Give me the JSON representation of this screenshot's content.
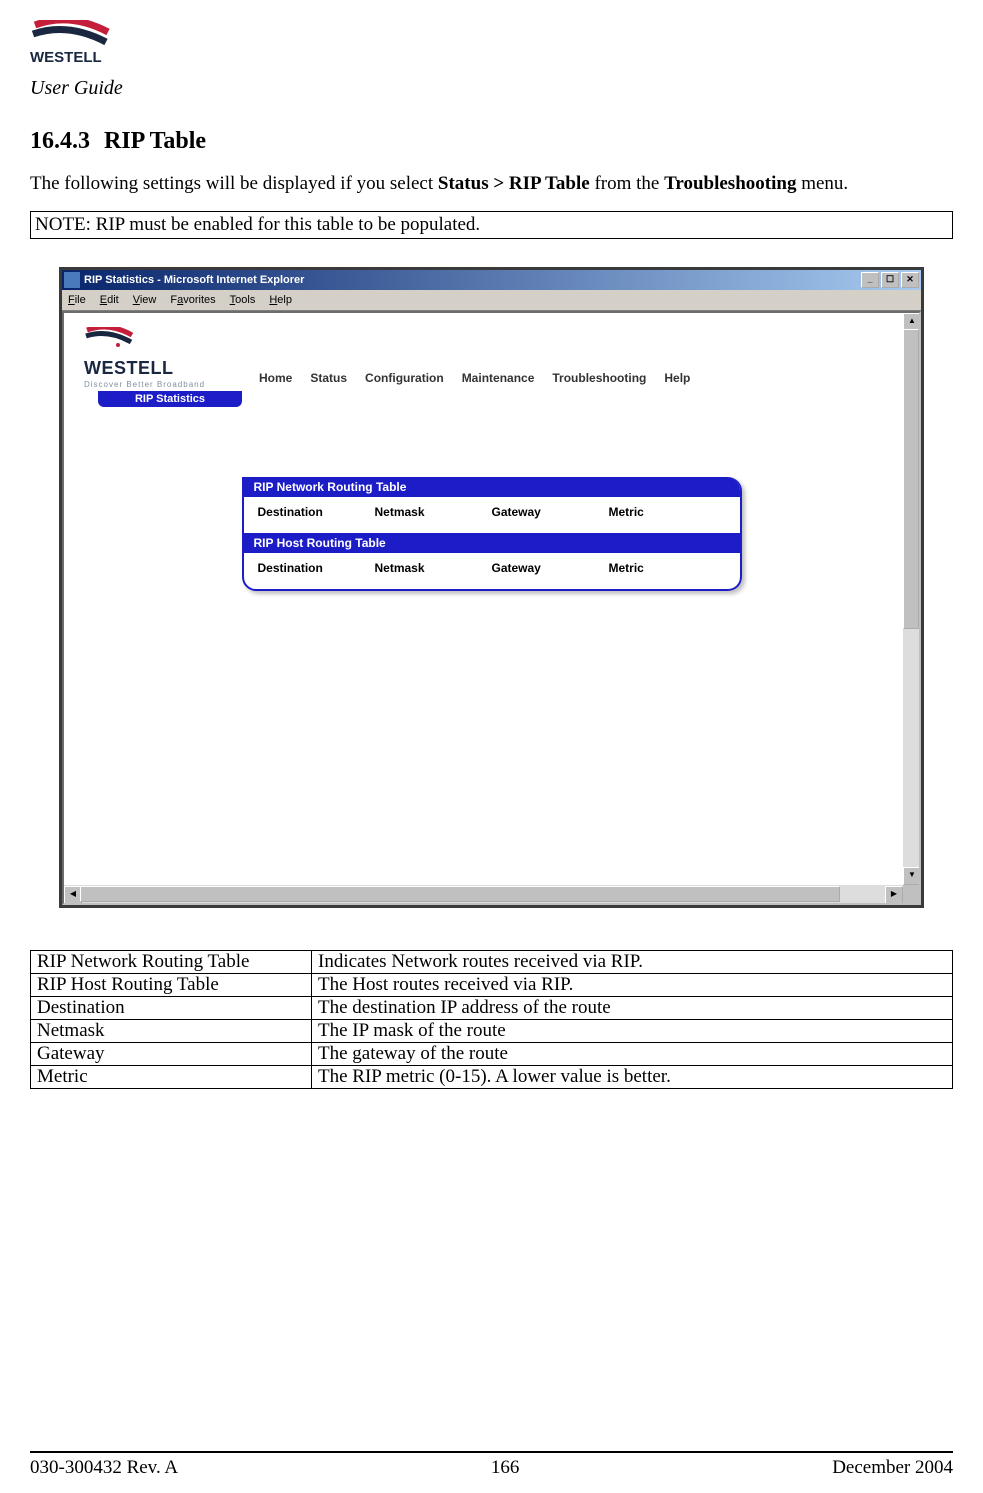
{
  "header": {
    "user_guide": "User Guide"
  },
  "section": {
    "number": "16.4.3",
    "title": "RIP Table"
  },
  "body": {
    "intro_pre": "The following settings will be displayed if you select ",
    "intro_bold1": "Status > RIP Table",
    "intro_mid": " from the ",
    "intro_bold2": "Troubleshooting",
    "intro_post": " menu.",
    "note": "NOTE: RIP must be enabled for this table to be populated."
  },
  "ie": {
    "title": "RIP Statistics - Microsoft Internet Explorer",
    "menu": [
      "File",
      "Edit",
      "View",
      "Favorites",
      "Tools",
      "Help"
    ]
  },
  "router": {
    "brand": "WESTELL",
    "tagline": "Discover Better Broadband",
    "nav": [
      "Home",
      "Status",
      "Configuration",
      "Maintenance",
      "Troubleshooting",
      "Help"
    ],
    "tab": "RIP Statistics",
    "panel1_title": "RIP Network Routing Table",
    "panel2_title": "RIP Host Routing Table",
    "cols": [
      "Destination",
      "Netmask",
      "Gateway",
      "Metric"
    ]
  },
  "desc_table": [
    {
      "term": "RIP Network Routing Table",
      "desc": "Indicates Network routes received via RIP."
    },
    {
      "term": "RIP Host Routing Table",
      "desc": "The Host routes received via RIP."
    },
    {
      "term": "Destination",
      "desc": "The destination IP address of the route"
    },
    {
      "term": "Netmask",
      "desc": "The IP mask of the route"
    },
    {
      "term": "Gateway",
      "desc": "The gateway of the route"
    },
    {
      "term": "Metric",
      "desc": "The RIP metric (0-15). A lower value is better."
    }
  ],
  "footer": {
    "left": "030-300432 Rev. A",
    "center": "166",
    "right": "December 2004"
  }
}
